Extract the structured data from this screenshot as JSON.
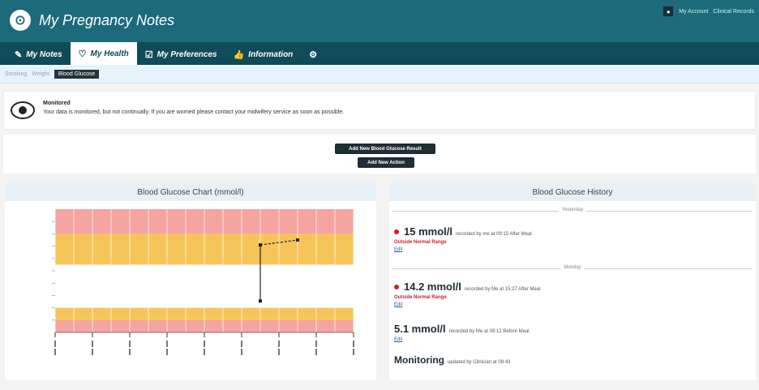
{
  "app": {
    "title": "My Pregnancy Notes",
    "logo_icon": "spiral-logo-icon"
  },
  "topright": {
    "chat_icon": "chat-icon",
    "account_label": "My Account",
    "logout_label": "Clinical Records"
  },
  "nav": {
    "tabs": [
      {
        "label": "My Notes",
        "icon": "edit-icon"
      },
      {
        "label": "My Health",
        "icon": "heart-icon"
      },
      {
        "label": "My Preferences",
        "icon": "checklist-icon"
      },
      {
        "label": "Information",
        "icon": "thumbs-up-icon"
      },
      {
        "label": "",
        "icon": "gear-icon"
      }
    ],
    "active_index": 1
  },
  "breadcrumbs": {
    "items": [
      "Smoking",
      "Weight"
    ],
    "active": "Blood Glucose"
  },
  "notice": {
    "title": "Monitored",
    "text": "Your data is monitored, but not continually. If you are worried please contact your midwifery service as soon as possible."
  },
  "actions": {
    "add_result": "Add New Blood Glucose Result",
    "add_action": "Add New Action"
  },
  "chart_panel": {
    "title": "Blood Glucose Chart (mmol/l)"
  },
  "chart_data": {
    "type": "line",
    "title": "Blood Glucose Chart (mmol/l)",
    "ylim": [
      0,
      20
    ],
    "bands": [
      {
        "from": 0,
        "to": 2,
        "color": "#f4a4a1"
      },
      {
        "from": 2,
        "to": 4,
        "color": "#f6c55a"
      },
      {
        "from": 4,
        "to": 11,
        "color": "#ffffff"
      },
      {
        "from": 11,
        "to": 16,
        "color": "#f6c55a"
      },
      {
        "from": 16,
        "to": 20,
        "color": "#f4a4a1"
      }
    ],
    "series": [
      {
        "values": [
          {
            "x": 5.5,
            "y": 5.1
          },
          {
            "x": 5.5,
            "y": 14.2
          },
          {
            "x": 6.5,
            "y": 15
          }
        ],
        "color": "#222222"
      }
    ],
    "xcount": 9,
    "grid": true
  },
  "history_panel": {
    "title": "Blood Glucose History",
    "groups": [
      {
        "label": "Yesterday",
        "entries": [
          {
            "value": "15 mmol/l",
            "meta": "recorded by me at 09:15 After Meal",
            "flag": "Outside Normal Range",
            "edit": "Edit",
            "has_dot": true
          }
        ]
      },
      {
        "label": "Monday",
        "entries": [
          {
            "value": "14.2 mmol/l",
            "meta": "recorded by Me at 15:27 After Meal",
            "flag": "Outside Normal Range",
            "edit": "Edit",
            "has_dot": true
          },
          {
            "value": "5.1 mmol/l",
            "meta": "recorded by Me at 09:12 Before Meal",
            "flag": "",
            "edit": "Edit",
            "has_dot": false
          },
          {
            "value": "Monitoring",
            "meta": "updated by Clinician at 08:43",
            "flag": "",
            "edit": "",
            "has_dot": false
          }
        ]
      }
    ]
  }
}
